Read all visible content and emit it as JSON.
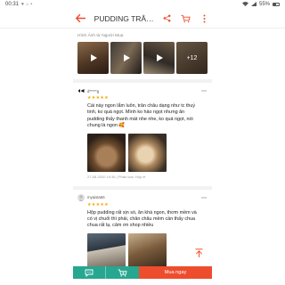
{
  "status_bar": {
    "time": "00:31",
    "notif_icons": "♥ ☼ •",
    "battery": "55%"
  },
  "header": {
    "title": "PUDDING TRÂN CHÂ...",
    "back_icon": "arrow-left-icon",
    "share_icon": "share-icon",
    "cart_icon": "cart-icon",
    "menu_icon": "more-vertical-icon",
    "accent": "#ee4d2d"
  },
  "buyer_photos": {
    "label": "Hình Ảnh từ Người Mua",
    "more_count": "+12"
  },
  "reviews": [
    {
      "username": "d*****g",
      "stars": "★★★★★",
      "text": "Cái này ngon lắm luôn, trân châu dạng như tc thuỷ tinh, ko quá ngọt. Mình ko hảo ngọt nhưng ăn pudding thấy thanh mát nhe nhe, ko quá ngọt, nói chung là ngon 🥰",
      "meta": "27-08-2020 19:36 | Phân loại: Hộp lẻ"
    },
    {
      "username": "myaista66",
      "stars": "★★★★★",
      "text": "Hộp pudding rất xịn sò, ăn khá ngon, thơm mềm và có vị chuối thì phải, chân châu mềm cần thấy chua chua rất lạ, cảm ơn shop nhiều"
    }
  ],
  "bottom_bar": {
    "chat_icon": "chat-icon",
    "add_cart_icon": "add-to-cart-icon",
    "buy_label": "Mua ngay",
    "chat_color": "#27a690",
    "buy_color": "#ee4d2d"
  },
  "scroll_top_icon": "arrow-up-icon"
}
